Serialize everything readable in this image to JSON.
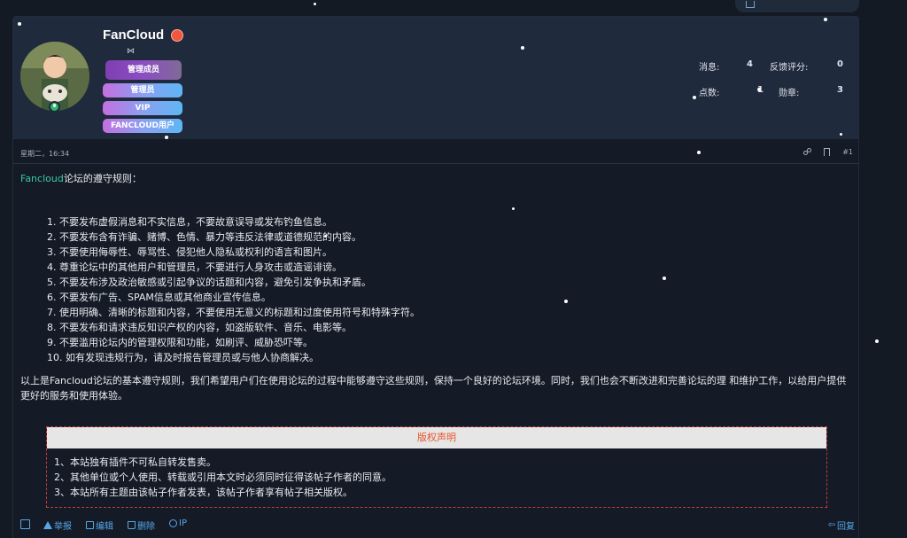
{
  "user": {
    "name": "FanCloud",
    "badges": [
      "管理成员",
      "管理员",
      "VIP",
      "FANCLOUD用户"
    ]
  },
  "stats": {
    "messages_label": "消息:",
    "messages_value": "4",
    "feedback_label": "反馈评分:",
    "feedback_value": "0",
    "points_label": "点数:",
    "points_value": "1",
    "medals_label": "勋章:",
    "medals_value": "3"
  },
  "post": {
    "date": "星期二，16:34",
    "number": "#1",
    "intro_highlight": "Fancloud",
    "intro_rest": "论坛的遵守规则：",
    "rules": [
      "1. 不要发布虚假消息和不实信息，不要故意误导或发布钓鱼信息。",
      "2. 不要发布含有诈骗、赌博、色情、暴力等违反法律或道德规范的内容。",
      "3. 不要使用侮辱性、辱骂性、侵犯他人隐私或权利的语言和图片。",
      "4. 尊重论坛中的其他用户和管理员，不要进行人身攻击或造谣诽谤。",
      "5. 不要发布涉及政治敏感或引起争议的话题和内容，避免引发争执和矛盾。",
      "6. 不要发布广告、SPAM信息或其他商业宣传信息。",
      "7. 使用明确、清晰的标题和内容，不要使用无意义的标题和过度使用符号和特殊字符。",
      "8. 不要发布和请求违反知识产权的内容，如盗版软件、音乐、电影等。",
      "9. 不要滥用论坛内的管理权限和功能，如刷评、威胁恐吓等。",
      "10. 如有发现违规行为，请及时报告管理员或与他人协商解决。"
    ],
    "summary": "以上是Fancloud论坛的基本遵守规则，我们希望用户们在使用论坛的过程中能够遵守这些规则，保持一个良好的论坛环境。同时，我们也会不断改进和完善论坛的理 和维护工作，以给用户提供更好的服务和使用体验。"
  },
  "copyright": {
    "title": "版权声明",
    "lines": [
      "1、本站独有插件不可私自转发售卖。",
      "2、其他单位或个人使用、转载或引用本文时必须同时征得该帖子作者的同意。",
      "3、本站所有主题由该帖子作者发表，该帖子作者享有帖子相关版权。"
    ]
  },
  "footer": {
    "report": "举报",
    "edit": "编辑",
    "delete": "删除",
    "ip": "IP",
    "reply": "回复"
  },
  "colors": {
    "accent": "#56a6e8",
    "highlight": "#3cc7a6",
    "copyright_title": "#e8542e"
  }
}
